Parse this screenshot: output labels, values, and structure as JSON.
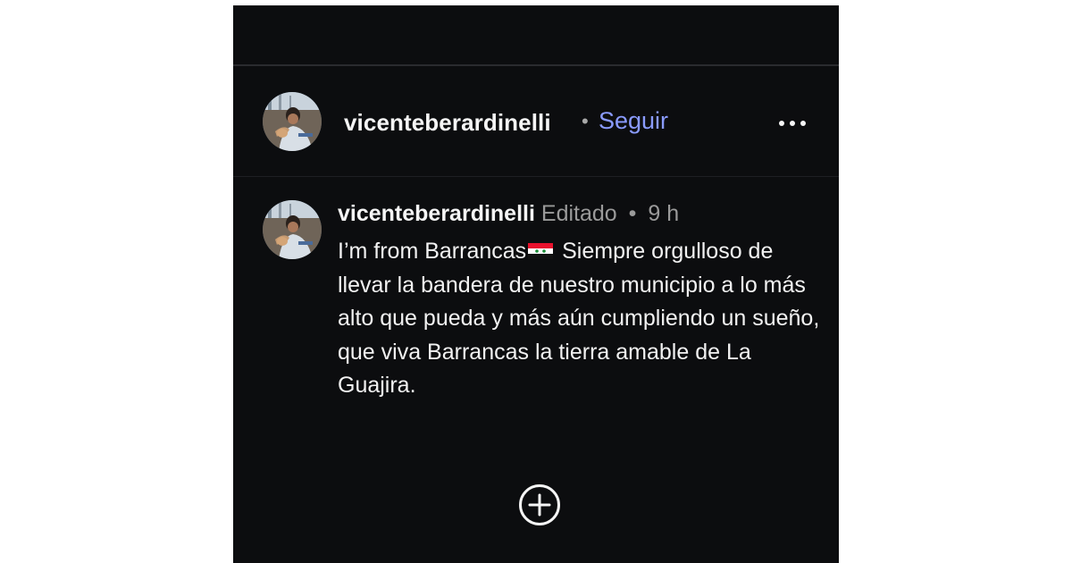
{
  "header": {
    "username": "vicenteberardinelli",
    "separator": "•",
    "follow_label": "Seguir",
    "more_icon": "more-horizontal-icon"
  },
  "comment": {
    "username": "vicenteberardinelli",
    "edited_label": "Editado",
    "separator": "•",
    "time": "9 h",
    "body_before_flag": "I’m from Barrancas",
    "flag_icon": "syria-flag-emoji",
    "body_after_flag": "Siempre orgulloso de llevar la bandera de nuestro municipio a lo más alto que pueda y más aún cumpliendo un sueño, que viva Barrancas la tierra amable de La Guajira."
  },
  "footer": {
    "add_icon": "plus-circle-icon"
  },
  "colors": {
    "background": "#0c0d0f",
    "link": "#8a9bff",
    "text": "#f5f5f5",
    "muted": "#9a9a9a"
  }
}
